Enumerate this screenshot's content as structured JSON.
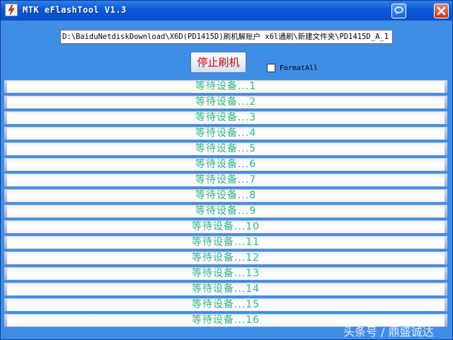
{
  "window": {
    "title": "MTK eFlashTool V1.3"
  },
  "main": {
    "file_path": "D:\\BaiduNetdiskDownload\\X6D(PD1415D)刷机解账户  x6l通刷\\新建文件夹\\PD1415D_A_1",
    "stop_button_label": "停止刷机",
    "format_all_label": "FormatAll",
    "format_all_checked": false
  },
  "devices": [
    {
      "label": "等待设备...1"
    },
    {
      "label": "等待设备...2"
    },
    {
      "label": "等待设备...3"
    },
    {
      "label": "等待设备...4"
    },
    {
      "label": "等待设备...5"
    },
    {
      "label": "等待设备...6"
    },
    {
      "label": "等待设备...7"
    },
    {
      "label": "等待设备...8"
    },
    {
      "label": "等待设备...9"
    },
    {
      "label": "等待设备...10"
    },
    {
      "label": "等待设备...11"
    },
    {
      "label": "等待设备...12"
    },
    {
      "label": "等待设备...13"
    },
    {
      "label": "等待设备...14"
    },
    {
      "label": "等待设备...15"
    },
    {
      "label": "等待设备...16"
    }
  ],
  "watermark": "头条号 / 鼎盛诚达",
  "colors": {
    "window_background": "#3f8ee6",
    "device_label": "#31b381",
    "stop_label": "#d00000"
  },
  "icons": {
    "app": "lightning-icon",
    "help": "speech-bubble-icon",
    "close": "close-icon"
  }
}
